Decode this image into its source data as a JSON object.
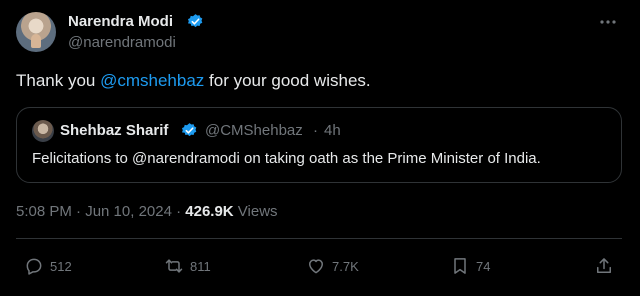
{
  "author": {
    "name": "Narendra Modi",
    "handle": "@narendramodi",
    "verified": true
  },
  "tweet": {
    "text_before": "Thank you ",
    "mention": "@cmshehbaz",
    "text_after": " for your good wishes."
  },
  "quote": {
    "name": "Shehbaz Sharif",
    "handle": "@CMShehbaz",
    "separator": "·",
    "time": "4h",
    "text": "Felicitations to @narendramodi on taking oath as the Prime Minister of India."
  },
  "meta": {
    "datetime": "5:08 PM · Jun 10, 2024 · ",
    "views_count": "426.9K",
    "views_label": " Views"
  },
  "actions": {
    "reply_count": "512",
    "retweet_count": "811",
    "like_count": "7.7K",
    "bookmark_count": "74"
  },
  "colors": {
    "background": "#000000",
    "accent": "#1d9bf0",
    "muted": "#71767b",
    "text": "#e7e9ea",
    "border": "#2f3336"
  },
  "icons": [
    "verified-badge-icon",
    "more-icon",
    "reply-icon",
    "retweet-icon",
    "like-icon",
    "bookmark-icon",
    "share-icon"
  ]
}
